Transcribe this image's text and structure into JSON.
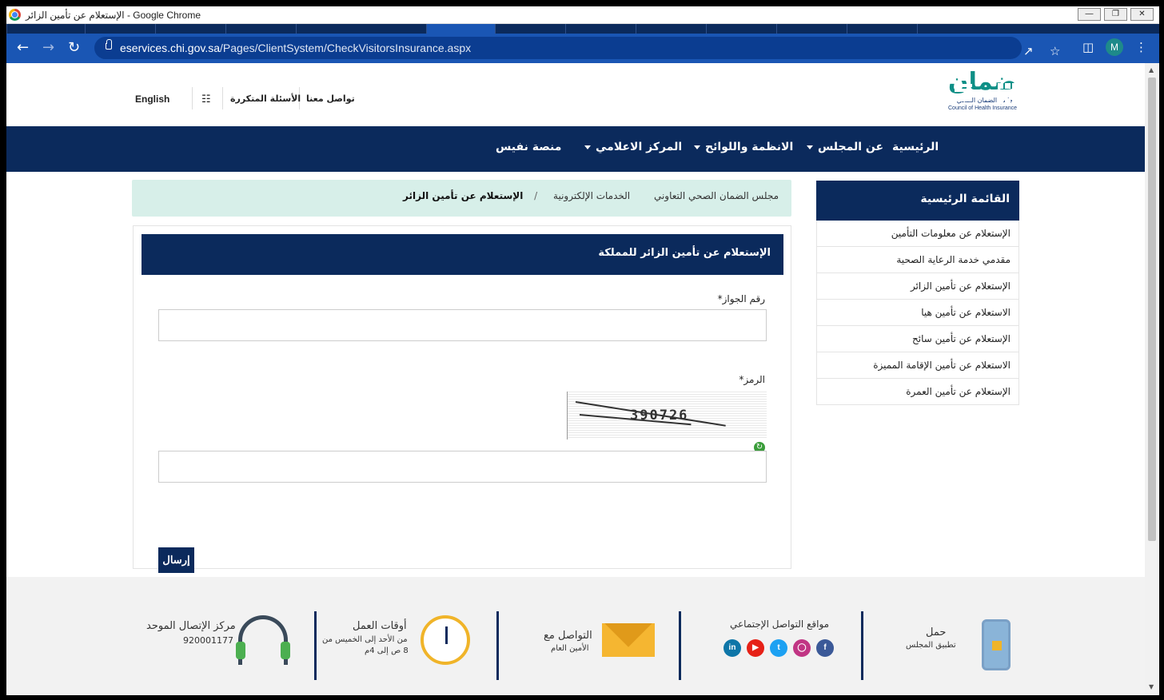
{
  "window": {
    "title": "الإستعلام عن تأمين الزائر - Google Chrome"
  },
  "browser": {
    "url_host": "eservices.chi.gov.sa",
    "url_path": "/Pages/ClientSystem/CheckVisitorsInsurance.aspx",
    "profile_initial": "M"
  },
  "header": {
    "logo": {
      "text_ar": "ضمان",
      "subtitle_ar": "مجلس الضمان الصحي",
      "subtitle_en": "Council of Health Insurance"
    },
    "links": {
      "contact": "تواصل معنا",
      "faq": "الأسئلة المتكررة",
      "english": "English"
    }
  },
  "nav": {
    "home": "الرئيسية",
    "about": "عن المجلس",
    "regulations": "الانظمة واللوائح",
    "media": "المركز الاعلامي",
    "nafis": "منصة نفيس"
  },
  "breadcrumb": {
    "root": "مجلس الضمان الصحي التعاوني",
    "section": "الخدمات الإلكترونية",
    "separator": "/",
    "current": "الإستعلام عن تأمين الزائر"
  },
  "sidebar": {
    "title": "القائمة الرئيسية",
    "items": [
      {
        "label": "الإستعلام عن معلومات التأمين"
      },
      {
        "label": "مقدمي خدمة الرعاية الصحية"
      },
      {
        "label": "الإستعلام عن تأمين الزائر"
      },
      {
        "label": "الاستعلام عن تأمين هيا"
      },
      {
        "label": "الإستعلام عن تأمين سائح"
      },
      {
        "label": "الاستعلام عن تأمين الإقامة المميزة"
      },
      {
        "label": "الإستعلام عن تأمين العمرة"
      }
    ]
  },
  "form": {
    "title": "الإستعلام عن تأمين الزائر للمملكة",
    "passport_label": "رقم الجواز*",
    "passport_value": "",
    "code_label": "الرمز*",
    "captcha_text": "390726",
    "code_value": "",
    "submit_label": "إرسال"
  },
  "footer": {
    "app": {
      "title": "حمل",
      "subtitle": "تطبيق المجلس"
    },
    "social": {
      "title": "مواقع التواصل الإجتماعي",
      "icons": [
        "facebook-icon",
        "instagram-icon",
        "twitter-icon",
        "youtube-icon",
        "linkedin-icon"
      ]
    },
    "contact": {
      "title": "التواصل مع",
      "subtitle": "الأمين العام"
    },
    "hours": {
      "title": "أوقات العمل",
      "line1": "من الأحد إلى الخميس من",
      "line2": "8 ص إلى 4م"
    },
    "call": {
      "title": "مركز الإتصال الموحد",
      "number": "920001177"
    }
  },
  "colors": {
    "navy": "#0b2a5c",
    "teal": "#0e8f86",
    "breadcrumb_bg": "#d7efe9",
    "chrome_blue": "#1a56b4"
  }
}
